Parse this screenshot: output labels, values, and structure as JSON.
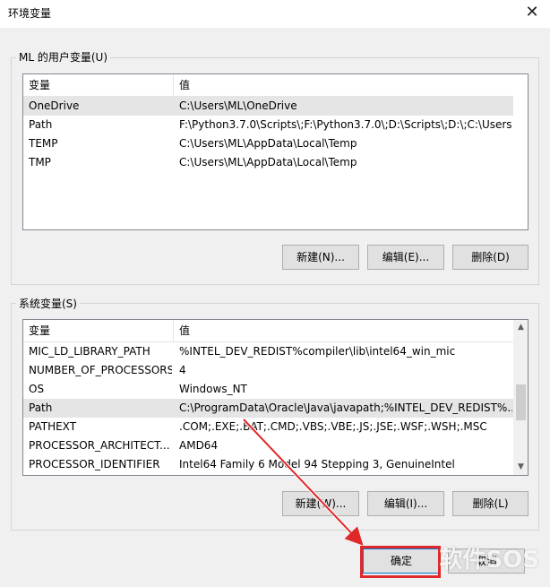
{
  "window": {
    "title": "环境变量",
    "close_glyph": "✕"
  },
  "user_vars": {
    "group_label": "ML 的用户变量(U)",
    "col_name": "变量",
    "col_value": "值",
    "rows": [
      {
        "name": "OneDrive",
        "value": "C:\\Users\\ML\\OneDrive"
      },
      {
        "name": "Path",
        "value": "F:\\Python3.7.0\\Scripts\\;F:\\Python3.7.0\\;D:\\Scripts\\;D:\\;C:\\Users..."
      },
      {
        "name": "TEMP",
        "value": "C:\\Users\\ML\\AppData\\Local\\Temp"
      },
      {
        "name": "TMP",
        "value": "C:\\Users\\ML\\AppData\\Local\\Temp"
      }
    ],
    "selected_index": 0,
    "btn_new": "新建(N)...",
    "btn_edit": "编辑(E)...",
    "btn_delete": "删除(D)"
  },
  "system_vars": {
    "group_label": "系统变量(S)",
    "col_name": "变量",
    "col_value": "值",
    "rows": [
      {
        "name": "MIC_LD_LIBRARY_PATH",
        "value": "%INTEL_DEV_REDIST%compiler\\lib\\intel64_win_mic"
      },
      {
        "name": "NUMBER_OF_PROCESSORS",
        "value": "4"
      },
      {
        "name": "OS",
        "value": "Windows_NT"
      },
      {
        "name": "Path",
        "value": "C:\\ProgramData\\Oracle\\Java\\javapath;%INTEL_DEV_REDIST%..."
      },
      {
        "name": "PATHEXT",
        "value": ".COM;.EXE;.BAT;.CMD;.VBS;.VBE;.JS;.JSE;.WSF;.WSH;.MSC"
      },
      {
        "name": "PROCESSOR_ARCHITECT...",
        "value": "AMD64"
      },
      {
        "name": "PROCESSOR_IDENTIFIER",
        "value": "Intel64 Family 6 Model 94 Stepping 3, GenuineIntel"
      }
    ],
    "selected_index": 3,
    "btn_new": "新建(W)...",
    "btn_edit": "编辑(I)...",
    "btn_delete": "删除(L)"
  },
  "footer": {
    "btn_ok": "确定",
    "btn_cancel": "取消"
  },
  "watermark": "软件SOS",
  "colors": {
    "annotation": "#e0282a",
    "selection": "#e5e5e5"
  },
  "icons": {
    "scroll_up": "▲",
    "scroll_down": "▼"
  }
}
